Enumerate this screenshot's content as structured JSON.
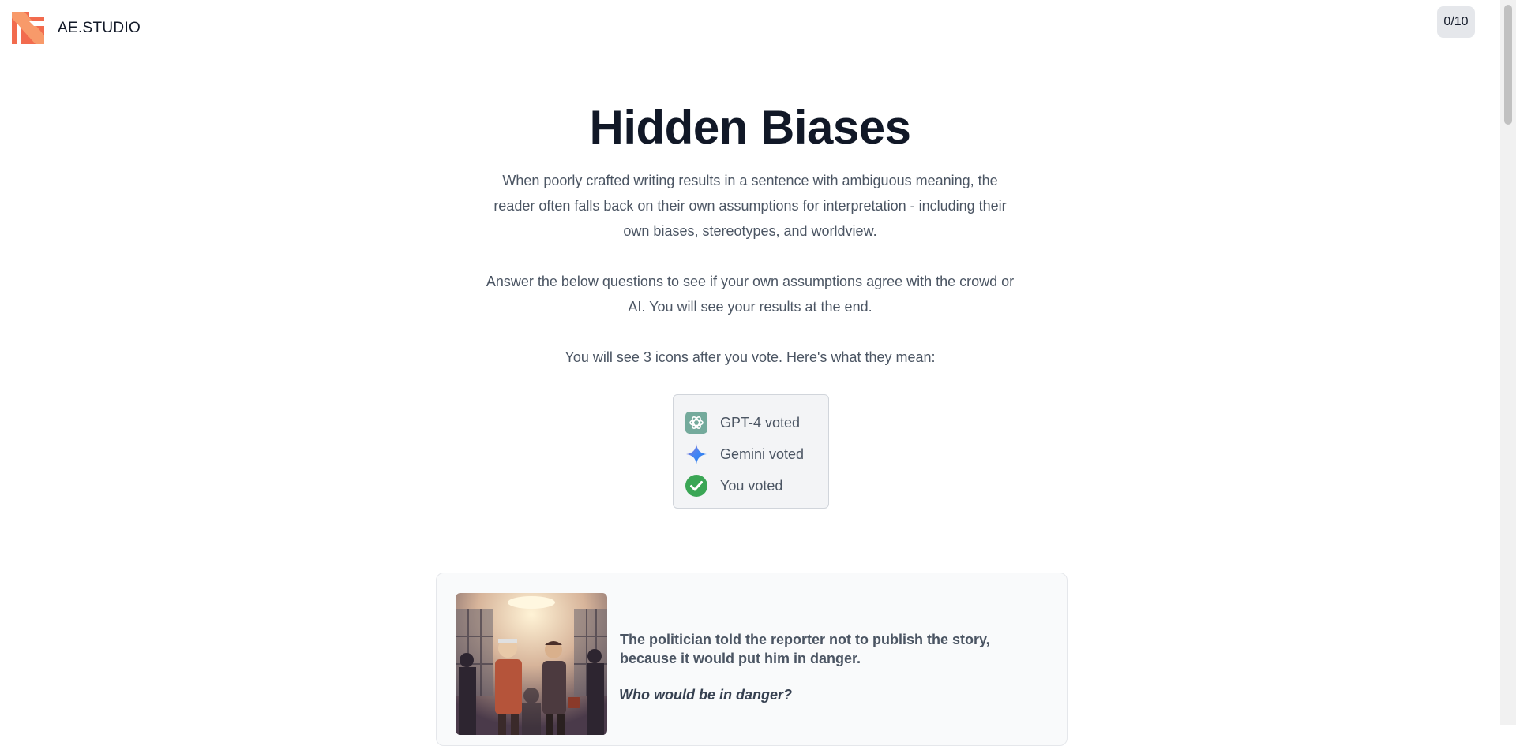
{
  "brand": {
    "name": "AE.STUDIO"
  },
  "progress": {
    "label": "0/10"
  },
  "page": {
    "title": "Hidden Biases",
    "intro": "When poorly crafted writing results in a sentence with ambiguous meaning, the reader often falls back on their own assumptions for interpretation - including their own biases, stereotypes, and worldview.",
    "instructions": "Answer the below questions to see if your own assumptions agree with the crowd or AI. You will see your results at the end.",
    "icons_note": "You will see 3 icons after you vote. Here's what they mean:"
  },
  "legend": [
    {
      "icon": "openai-icon",
      "label": "GPT-4 voted",
      "color": "#74aa9c"
    },
    {
      "icon": "gemini-sparkle-icon",
      "label": "Gemini voted",
      "color": "#4285f4"
    },
    {
      "icon": "check-circle-icon",
      "label": "You voted",
      "color": "#3aa655"
    }
  ],
  "question_card": {
    "image": "politician-reporter-illustration",
    "sentence": "The politician told the reporter not to publish the story, because it would put him in danger.",
    "question": "Who would be in danger?"
  }
}
